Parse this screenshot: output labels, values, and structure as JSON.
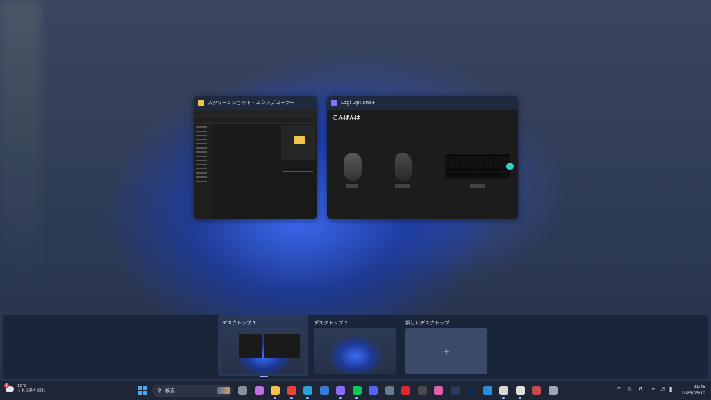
{
  "windows": {
    "explorer": {
      "title": "スクリーンショット - エクスプローラー"
    },
    "logi": {
      "title": "Logi Options+",
      "greeting": "こんばんは"
    }
  },
  "desktops": {
    "items": [
      {
        "label": "デスクトップ 1"
      },
      {
        "label": "デスクトップ 2"
      }
    ],
    "new_label": "新しいデスクトップ",
    "new_icon": "+"
  },
  "taskbar": {
    "weather": {
      "temp": "18°C",
      "condition": "くもり時々 晴れ",
      "badge": "1"
    },
    "search": {
      "placeholder": "検索",
      "icon": "search-icon"
    },
    "pinned_icons": [
      {
        "name": "task-view-icon",
        "color": "#8a8f99"
      },
      {
        "name": "copilot-icon",
        "color": "#c070e0"
      },
      {
        "name": "file-explorer-icon",
        "color": "#f3c34a"
      },
      {
        "name": "chrome-icon",
        "color": "#e8453c"
      },
      {
        "name": "edge-icon",
        "color": "#2aa0d8"
      },
      {
        "name": "store-icon",
        "color": "#3a7bd5"
      },
      {
        "name": "logi-options-icon",
        "color": "#8a6cff"
      },
      {
        "name": "line-icon",
        "color": "#06c755"
      },
      {
        "name": "discord-icon",
        "color": "#5865f2"
      },
      {
        "name": "calculator-icon",
        "color": "#6a7a90"
      },
      {
        "name": "uniqlo-icon",
        "color": "#e0262f"
      },
      {
        "name": "davinci-icon",
        "color": "#4a4a4a"
      },
      {
        "name": "photos-icon",
        "color": "#e060b0"
      },
      {
        "name": "lightroom-icon",
        "color": "#2a3a5a"
      },
      {
        "name": "photoshop-icon",
        "color": "#0f2a4a"
      },
      {
        "name": "vscode-icon",
        "color": "#2a8ee0"
      },
      {
        "name": "snipping-icon",
        "color": "#d8d8d8"
      },
      {
        "name": "obs-icon",
        "color": "#e0e0e0"
      },
      {
        "name": "paint-icon",
        "color": "#c84a4a"
      },
      {
        "name": "settings-icon",
        "color": "#a0a8b8"
      }
    ],
    "tray": {
      "chevron": "^",
      "brightness_icon": "sun-icon",
      "ime": "A",
      "wifi_icon": "wifi-icon",
      "volume_icon": "volume-icon",
      "battery_icon": "battery-icon"
    },
    "clock": {
      "time": "21:45",
      "date": "2025/05/10"
    }
  }
}
